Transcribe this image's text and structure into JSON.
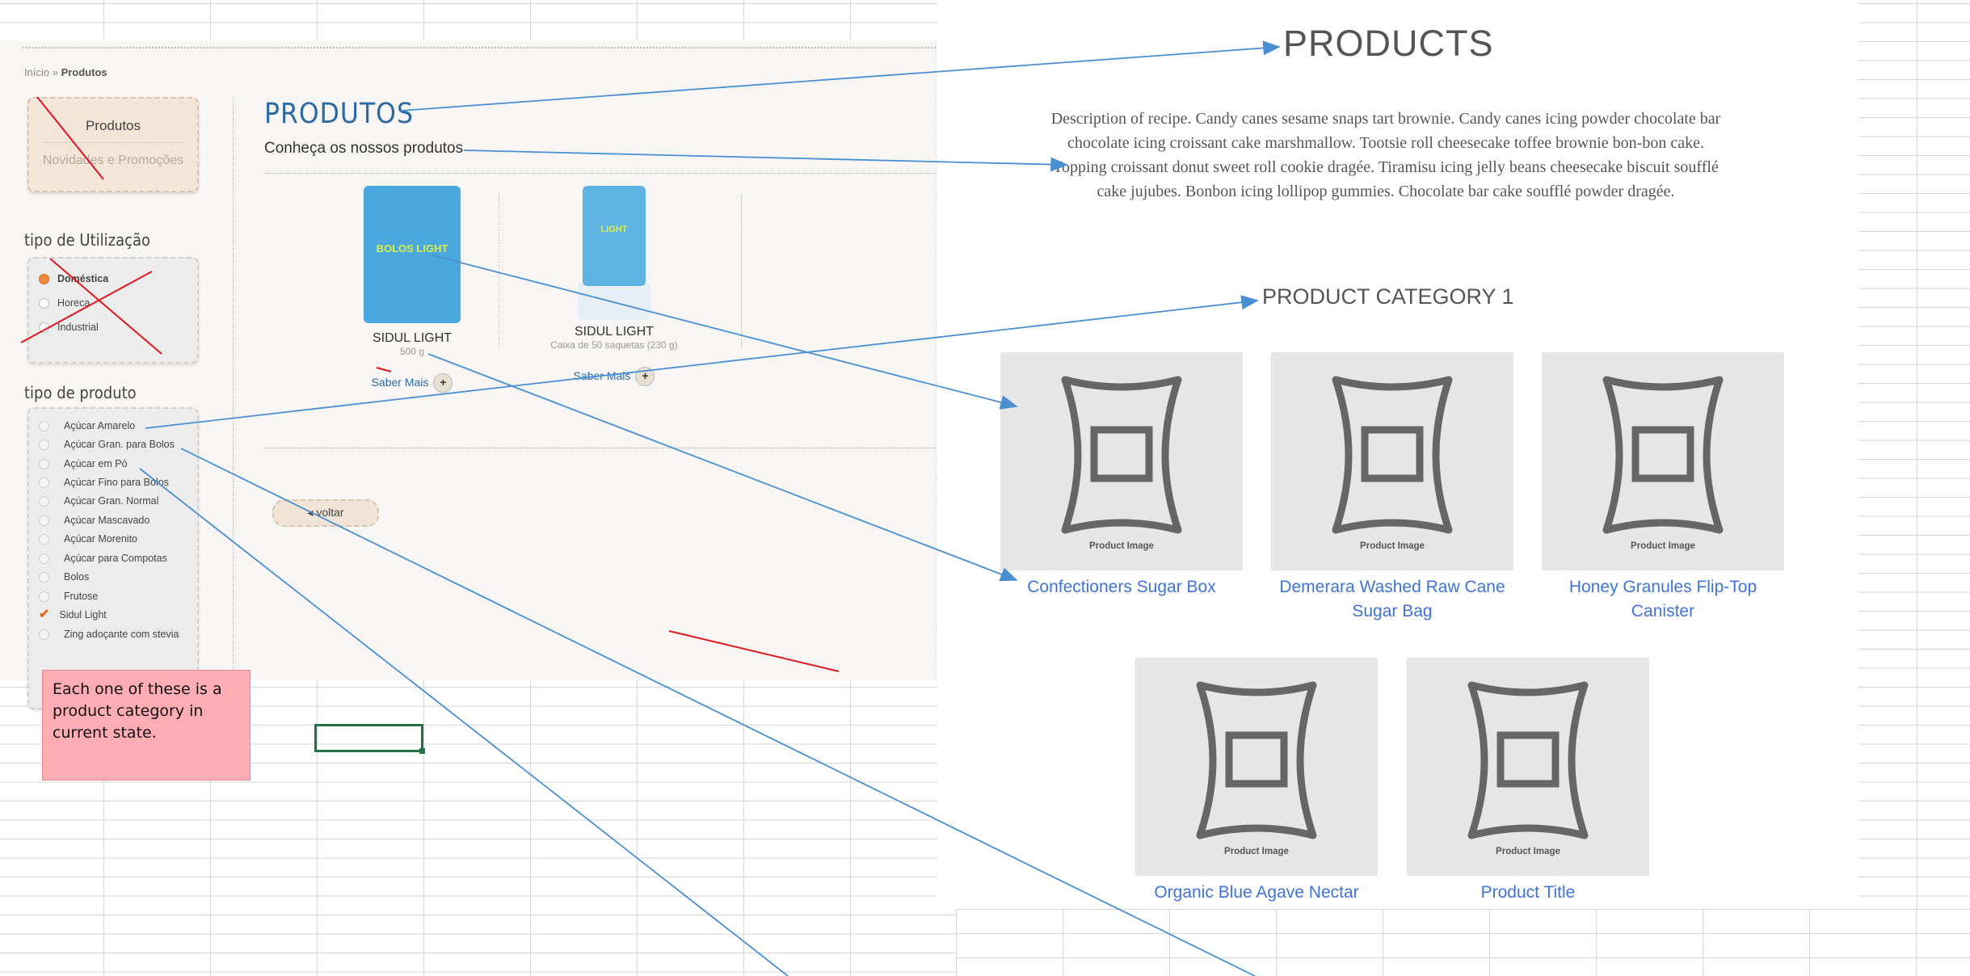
{
  "left_site": {
    "breadcrumb": {
      "home": "Início",
      "sep": "»",
      "current": "Produtos"
    },
    "nav_card": {
      "title": "Produtos",
      "sub": "Novidades e Promoções"
    },
    "usage": {
      "title": "tipo de Utilização",
      "options": [
        {
          "label": "Doméstica",
          "selected": true
        },
        {
          "label": "Horeca",
          "selected": false
        },
        {
          "label": "Industrial",
          "selected": false
        }
      ]
    },
    "product_type": {
      "title": "tipo de produto",
      "options": [
        {
          "label": "Açúcar Amarelo",
          "checked": false
        },
        {
          "label": "Açúcar Gran. para Bolos",
          "checked": false
        },
        {
          "label": "Açúcar em Pó",
          "checked": false
        },
        {
          "label": "Açúcar Fino para Bolos",
          "checked": false
        },
        {
          "label": "Açúcar Gran. Normal",
          "checked": false
        },
        {
          "label": "Açúcar Mascavado",
          "checked": false
        },
        {
          "label": "Açúcar Morenito",
          "checked": false
        },
        {
          "label": "Açúcar para Compotas",
          "checked": false
        },
        {
          "label": "Bolos",
          "checked": false
        },
        {
          "label": "Frutose",
          "checked": false
        },
        {
          "label": "Sidul Light",
          "checked": true
        },
        {
          "label": "Zing adoçante com stevia",
          "checked": false
        }
      ]
    },
    "main": {
      "title": "PRODUTOS",
      "subtitle": "Conheça os nossos produtos",
      "products": [
        {
          "name": "SIDUL LIGHT",
          "desc": "500 g",
          "more": "Saber Mais",
          "plus": "+",
          "box_text": "BOLOS LIGHT"
        },
        {
          "name": "SIDUL LIGHT",
          "desc": "Caixa de 50 saquetas (230 g)",
          "more": "Saber Mais",
          "plus": "+",
          "box_text": "LIGHT"
        }
      ],
      "back": "◂ voltar"
    }
  },
  "note": "Each one of these is a product category in current state.",
  "mockup": {
    "title": "PRODUCTS",
    "description": "Description of recipe. Candy canes sesame snaps tart brownie. Candy canes icing powder chocolate bar chocolate icing croissant cake marshmallow. Tootsie roll cheesecake toffee brownie bon-bon cake. Topping croissant donut sweet roll cookie dragée. Tiramisu icing jelly beans cheesecake biscuit soufflé cake jujubes. Bonbon icing lollipop gummies. Chocolate bar cake soufflé powder dragée.",
    "category": "PRODUCT CATEGORY 1",
    "image_caption": "Product Image",
    "products": [
      {
        "title": "Confectioners Sugar Box"
      },
      {
        "title": "Demerara Washed Raw Cane Sugar Bag"
      },
      {
        "title": "Honey Granules Flip-Top Canister"
      },
      {
        "title": "Organic Blue Agave Nectar Syrup Bottle"
      },
      {
        "title": "Product Title"
      }
    ]
  },
  "colors": {
    "arrow": "#4a8fd1",
    "strike": "#e0161e",
    "link": "#3f74d6",
    "note_bg": "#ffadb4"
  }
}
